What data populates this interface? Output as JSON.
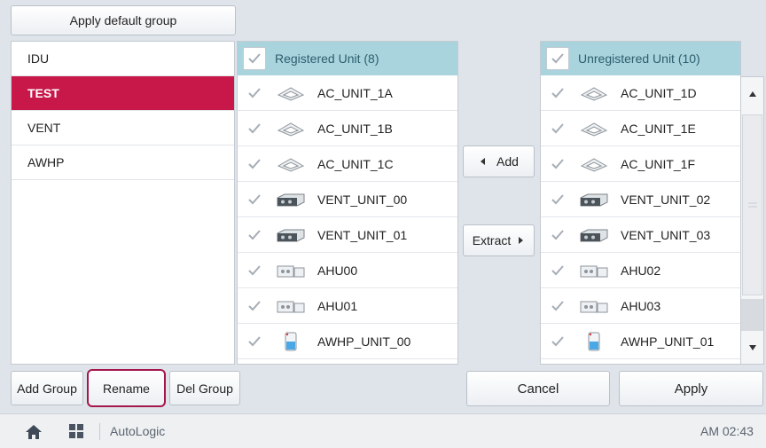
{
  "toolbar": {
    "apply_default_group": "Apply default group"
  },
  "groups": [
    {
      "label": "IDU",
      "selected": false
    },
    {
      "label": "TEST",
      "selected": true
    },
    {
      "label": "VENT",
      "selected": false
    },
    {
      "label": "AWHP",
      "selected": false
    }
  ],
  "registered": {
    "header": "Registered Unit (8)",
    "units": [
      {
        "name": "AC_UNIT_1A",
        "icon": "cassette-ac-icon"
      },
      {
        "name": "AC_UNIT_1B",
        "icon": "cassette-ac-icon"
      },
      {
        "name": "AC_UNIT_1C",
        "icon": "cassette-ac-icon"
      },
      {
        "name": "VENT_UNIT_00",
        "icon": "ventilation-unit-icon"
      },
      {
        "name": "VENT_UNIT_01",
        "icon": "ventilation-unit-icon"
      },
      {
        "name": "AHU00",
        "icon": "air-handling-unit-icon"
      },
      {
        "name": "AHU01",
        "icon": "air-handling-unit-icon"
      },
      {
        "name": "AWHP_UNIT_00",
        "icon": "awhp-hydrokit-icon"
      }
    ]
  },
  "unregistered": {
    "header": "Unregistered Unit (10)",
    "units": [
      {
        "name": "AC_UNIT_1D",
        "icon": "cassette-ac-icon"
      },
      {
        "name": "AC_UNIT_1E",
        "icon": "cassette-ac-icon"
      },
      {
        "name": "AC_UNIT_1F",
        "icon": "cassette-ac-icon"
      },
      {
        "name": "VENT_UNIT_02",
        "icon": "ventilation-unit-icon"
      },
      {
        "name": "VENT_UNIT_03",
        "icon": "ventilation-unit-icon"
      },
      {
        "name": "AHU02",
        "icon": "air-handling-unit-icon"
      },
      {
        "name": "AHU03",
        "icon": "air-handling-unit-icon"
      },
      {
        "name": "AWHP_UNIT_01",
        "icon": "awhp-hydrokit-icon"
      }
    ]
  },
  "actions": {
    "add": "Add",
    "extract": "Extract"
  },
  "group_buttons": {
    "add_group": "Add Group",
    "rename": "Rename",
    "del_group": "Del Group"
  },
  "footer_buttons": {
    "cancel": "Cancel",
    "apply": "Apply"
  },
  "statusbar": {
    "app_name": "AutoLogic",
    "time": "AM 02:43"
  },
  "colors": {
    "selected_group": "#c8184a",
    "header_bg": "#a9d4de",
    "rename_highlight": "#a4174a"
  }
}
